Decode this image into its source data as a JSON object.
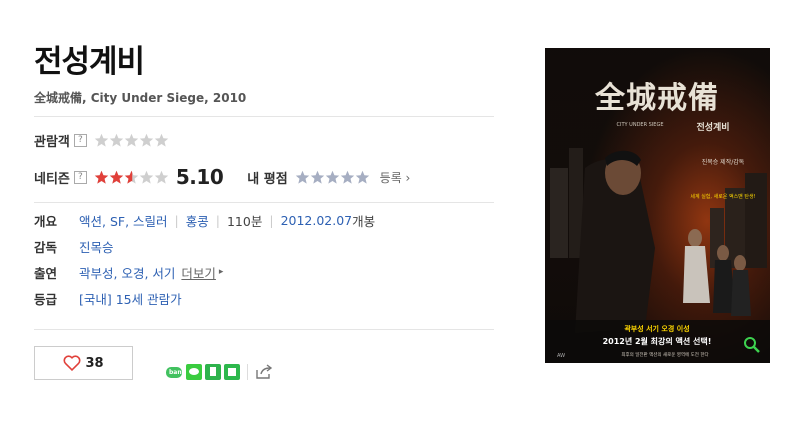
{
  "movie": {
    "title": "전성계비",
    "subtitle": "全城戒備, City Under Siege, 2010"
  },
  "ratings": {
    "audience_label": "관람객",
    "audience_help": "?",
    "audience_stars": 0,
    "netizen_label": "네티즌",
    "netizen_help": "?",
    "netizen_stars": 2.55,
    "netizen_score": "5.10",
    "my_rating_label": "내 평점",
    "my_rating_stars": 0,
    "register_label": "등록 ›"
  },
  "info": {
    "overview_label": "개요",
    "genres": "액션, SF, 스릴러",
    "country": "홍콩",
    "runtime": "110분",
    "release": "2012.02.07",
    "release_suffix": " 개봉",
    "director_label": "감독",
    "director": "진목승",
    "cast_label": "출연",
    "cast": "곽부성, 오경, 서기",
    "cast_more": "더보기",
    "grade_label": "등급",
    "grade": "[국내] 15세 관람가"
  },
  "actions": {
    "like_count": "38"
  },
  "share_icons": [
    "band-icon",
    "line-icon",
    "bookmark-icon",
    "green-share-icon",
    "share-out-icon"
  ],
  "poster": {
    "title_art": "全城戒備",
    "title_ko": "전성계비",
    "en_title": "CITY UNDER SIEGE",
    "director_credit": "진목승 제작/감독",
    "tagline": "세계 실험, 새로운 액스맨 탄생!",
    "cast_line": "곽부성   서기   오경   이성",
    "release_line": "2012년 2월 최강의 액션 선택!",
    "bottom_line": "최후의 일전판 액션의 새로운 영역에 도전 한다",
    "brand": "AW"
  },
  "colors": {
    "star_red": "#e1403a",
    "star_gray": "#cfcfcf",
    "star_blue_gray": "#a6aec2",
    "link_blue": "#2e61b3",
    "poster_yellow": "#ffd800"
  }
}
